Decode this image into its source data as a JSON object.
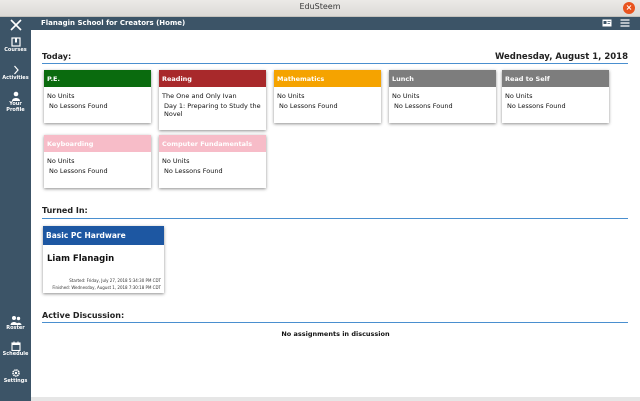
{
  "window": {
    "title": "EduSteem",
    "close_glyph": "×"
  },
  "appbar": {
    "title": "Flanagin School for Creators (Home)",
    "icons": [
      "id-card-icon",
      "menu-icon"
    ]
  },
  "sidebar": {
    "items": [
      {
        "label": "Courses",
        "icon": "book-icon"
      },
      {
        "label": "Activities",
        "icon": "chevron-right-icon"
      },
      {
        "label": "Your Profile",
        "icon": "user-icon"
      },
      {
        "label": "Roster",
        "icon": "people-icon"
      },
      {
        "label": "Schedule",
        "icon": "calendar-icon"
      },
      {
        "label": "Settings",
        "icon": "gear-icon"
      }
    ]
  },
  "today": {
    "heading": "Today:",
    "date": "Wednesday, August 1, 2018",
    "cards": [
      {
        "title": "P.E.",
        "color": "#0a6b0e",
        "line1": "No Units",
        "line2": "No Lessons Found"
      },
      {
        "title": "Reading",
        "color": "#a8292b",
        "line1": "The One and Only Ivan",
        "line2": "Day 1: Preparing to Study the Novel"
      },
      {
        "title": "Mathematics",
        "color": "#f5a300",
        "line1": "No Units",
        "line2": "No Lessons Found"
      },
      {
        "title": "Lunch",
        "color": "#7d7d7d",
        "line1": "No Units",
        "line2": "No Lessons Found"
      },
      {
        "title": "Read to Self",
        "color": "#7d7d7d",
        "line1": "No Units",
        "line2": "No Lessons Found"
      },
      {
        "title": "Keyboarding",
        "color": "#f7bcc8",
        "line1": "No Units",
        "line2": "No Lessons Found"
      },
      {
        "title": "Computer Fundamentals",
        "color": "#f7bcc8",
        "line1": "No Units",
        "line2": "No Lessons Found"
      }
    ]
  },
  "turned_in": {
    "heading": "Turned In:",
    "card": {
      "course": "Basic PC Hardware",
      "student": "Liam Flanagin",
      "started": "Started: Friday, July 27, 2018 5:34:30 PM CDT",
      "finished": "Finished: Wednesday, August 1, 2018 7:30:18 PM CDT"
    }
  },
  "discussion": {
    "heading": "Active Discussion:",
    "empty_text": "No assignments in discussion"
  }
}
